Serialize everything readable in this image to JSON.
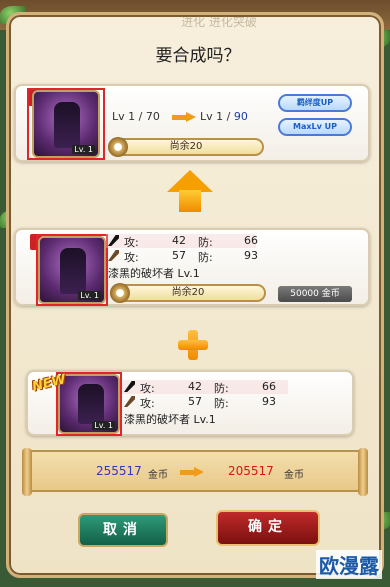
{
  "dialog": {
    "header_faded": "进化  进化突破",
    "title": "要合成吗？"
  },
  "target": {
    "level_from": "Lv 1 / 70",
    "level_to_prefix": "Lv 1 /",
    "level_to_max": "90",
    "bond_up": "羁绊度UP",
    "maxlv_up": "MaxLv UP",
    "remaining": "尚余20",
    "thumb_lv": "Lv. 1"
  },
  "material": {
    "atk1_label": "攻:",
    "atk1": "42",
    "def1_label": "防:",
    "def1": "66",
    "atk2_label": "攻:",
    "atk2": "57",
    "def2_label": "防:",
    "def2": "93",
    "name": "漆黑的破坏者  Lv.1",
    "remaining": "尚余20",
    "cost": "50000 金币",
    "thumb_lv": "Lv. 1"
  },
  "new_item": {
    "badge": "NEW",
    "atk1_label": "攻:",
    "atk1": "42",
    "def1_label": "防:",
    "def1": "66",
    "atk2_label": "攻:",
    "atk2": "57",
    "def2_label": "防:",
    "def2": "93",
    "name": "漆黑的破坏者  Lv.1",
    "thumb_lv": "Lv. 1"
  },
  "gold": {
    "before": "255517",
    "after": "205517",
    "unit": "金币"
  },
  "buttons": {
    "cancel": "取消",
    "confirm": "确定"
  },
  "watermark": "欧漫露",
  "colors": {
    "accent_orange": "#f29a1a",
    "level_blue": "#1e3ca8",
    "gold_new_red": "#d01818",
    "cancel_green": "#126048",
    "confirm_red": "#7a1010"
  }
}
